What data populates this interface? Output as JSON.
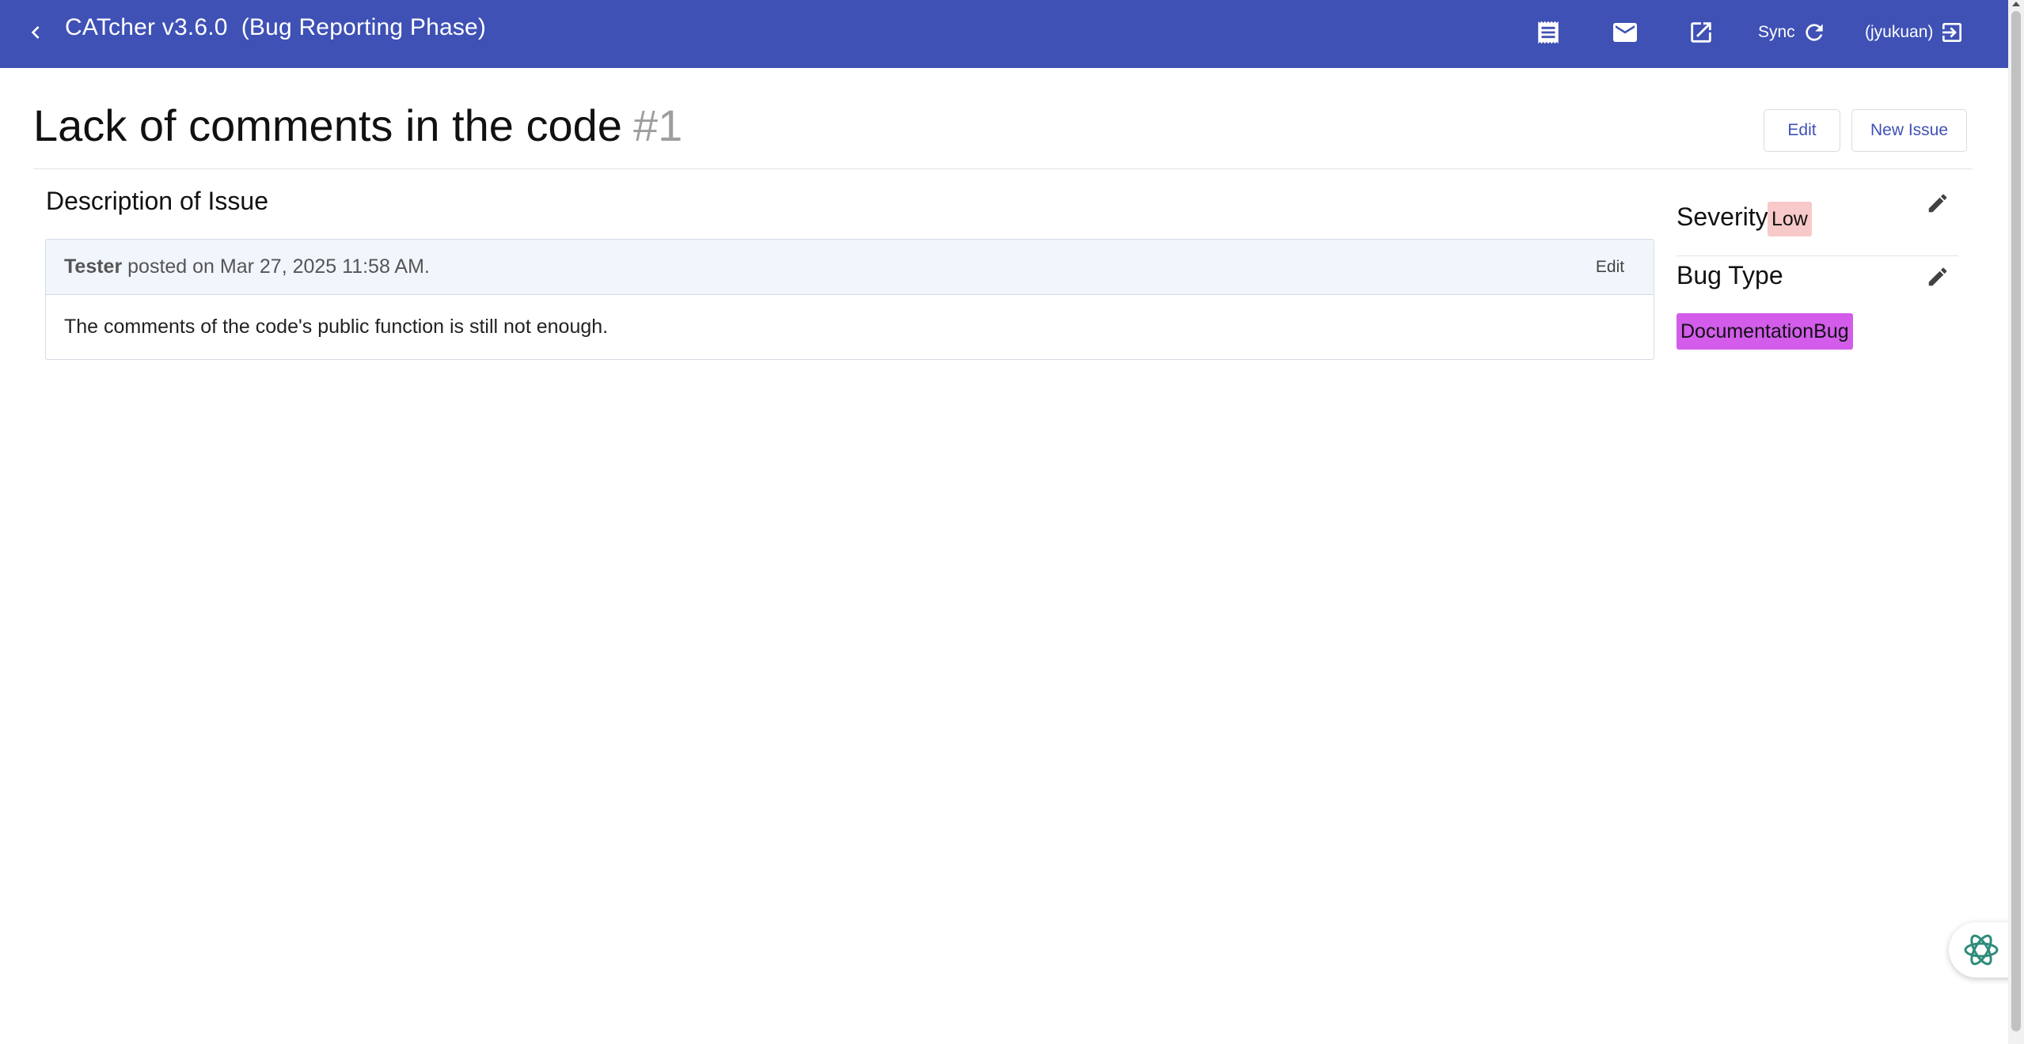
{
  "toolbar": {
    "app_title": "CATcher v3.6.0  (Bug Reporting Phase)",
    "icons": [
      "arrow-back-icon",
      "receipt-icon",
      "mail-icon",
      "open-in-new-icon",
      "refresh-icon",
      "logout-icon"
    ],
    "sync_label": "Sync",
    "user_label": "(jyukuan)"
  },
  "issue": {
    "title": "Lack of comments in the code",
    "number": "#1",
    "edit_label": "Edit",
    "new_issue_label": "New Issue"
  },
  "description": {
    "heading": "Description of Issue",
    "comment": {
      "author": "Tester",
      "meta": " posted on Mar 27, 2025 11:58 AM.",
      "edit_label": "Edit",
      "body": "The comments of the code's public function is still not enough."
    }
  },
  "side_panel": {
    "severity_label": "Severity",
    "severity_value": "Low",
    "bug_type_label": "Bug Type",
    "bug_type_value": "DocumentationBug",
    "edit_icon": "pencil-icon"
  },
  "colors": {
    "toolbar_bg": "#3f51b5",
    "accent": "#3f51b5",
    "severity_badge": "#f8c9c9",
    "bug_type_badge": "#d35ceb",
    "comment_header_bg": "#f1f6fc"
  }
}
